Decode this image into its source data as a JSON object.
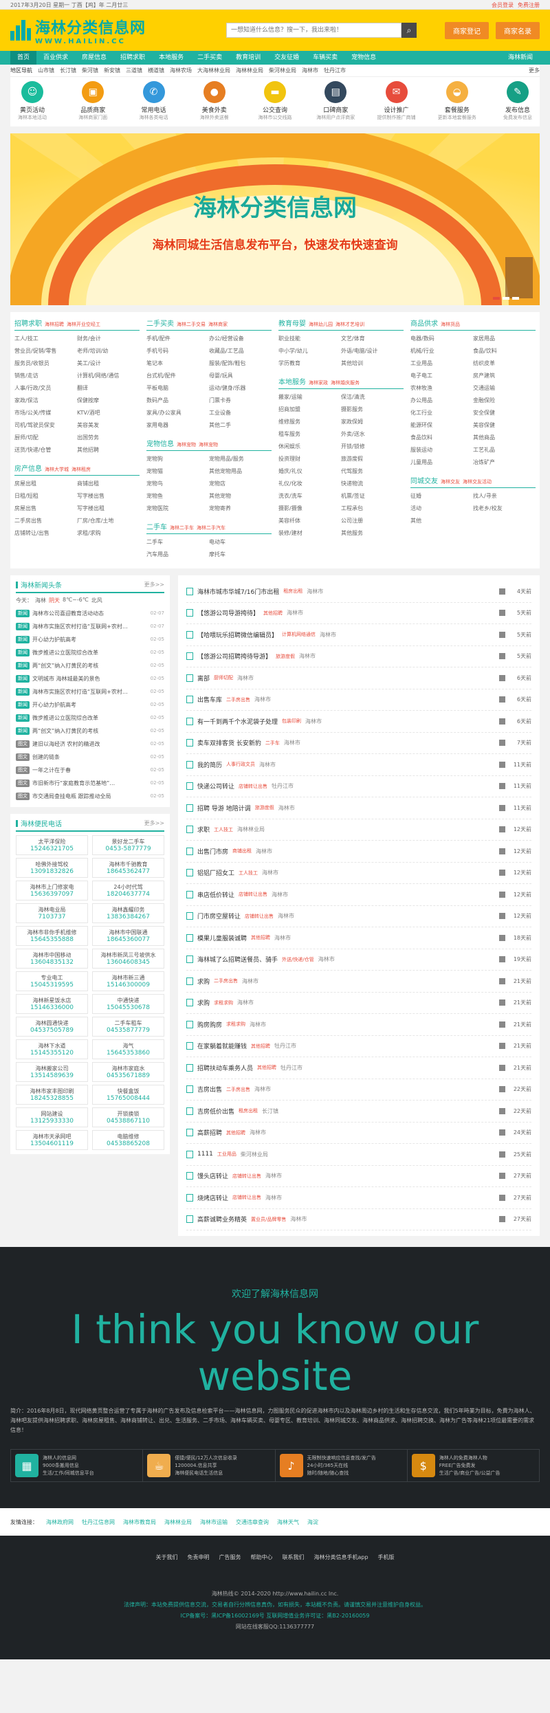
{
  "topbar": {
    "date": "2017年3月20日 星期一 丁酉【鸡】年 二月廿三",
    "login": "会员登录",
    "register": "免费注册"
  },
  "header": {
    "logo_cn": "海林分类信息网",
    "logo_en": "WWW.HAILIN.CC",
    "search_placeholder": "一想知道什么信息？搜一下，我出来啦！",
    "btn1": "商家登记",
    "btn2": "商家名录"
  },
  "nav": {
    "items": [
      "首页",
      "百业供求",
      "房屋信息",
      "招聘求职",
      "本地服务",
      "二手买卖",
      "教育培训",
      "交友征婚",
      "车辆买卖",
      "宠物信息"
    ],
    "last": "海林新闻"
  },
  "subnav": {
    "label": "地区导航",
    "areas": [
      "山市镇",
      "长汀镇",
      "柴河镇",
      "新安镇",
      "三道镇",
      "横道镇",
      "海林农场",
      "大海林林业局",
      "海林林业局",
      "柴河林业局",
      "海林市",
      "牡丹江市"
    ],
    "more": "更多"
  },
  "icons": [
    {
      "t": "黄页活动",
      "s": "海林本地活动",
      "c": "#1abc9c",
      "g": "☺"
    },
    {
      "t": "品质商家",
      "s": "海林商家门面",
      "c": "#f39c12",
      "g": "▣"
    },
    {
      "t": "常用电话",
      "s": "海林各类电话",
      "c": "#3498db",
      "g": "✆"
    },
    {
      "t": "美食外卖",
      "s": "海林外卖送餐",
      "c": "#e67e22",
      "g": "●"
    },
    {
      "t": "公交查询",
      "s": "海林市公交线路",
      "c": "#f1c40f",
      "g": "▬"
    },
    {
      "t": "口碑商家",
      "s": "海林用户点评商家",
      "c": "#34495e",
      "g": "▤"
    },
    {
      "t": "设计推广",
      "s": "提供制作推广商铺",
      "c": "#e74c3c",
      "g": "✉"
    },
    {
      "t": "套餐服务",
      "s": "更新本地套餐服务",
      "c": "#f5b041",
      "g": "◒"
    },
    {
      "t": "发布信息",
      "s": "免费发布信息",
      "c": "#16a085",
      "g": "✎"
    }
  ],
  "banner": {
    "title": "海林分类信息网",
    "sub": "海林同城生活信息发布平台，快速发布快速查询"
  },
  "cats": [
    {
      "h": "招聘求职",
      "tag": "海林招聘",
      "tag2": "海林开业空经工",
      "items": [
        "工人/技工",
        "财务/会计",
        "营业员/促销/零售",
        "老师/培训/幼",
        "服务员/收银员",
        "美工/设计",
        "销售/走访",
        "计算机/网络/通信",
        "人事/行政/文员",
        "翻译",
        "家政/保洁",
        "保健按摩",
        "市场/公关/传媒",
        "KTV/酒吧",
        "司机/驾驶员保安",
        "美容美发",
        "厨师/切配",
        "出国劳务",
        "送货/快递/仓管",
        "其他招聘"
      ]
    },
    {
      "h": "二手买卖",
      "tag": "海林二手交易",
      "tag2": "海林商家",
      "items": [
        "手机/配件",
        "办公/经营设备",
        "手机号码",
        "收藏品/工艺品",
        "笔记本",
        "服装/配饰/鞋包",
        "台式机/配件",
        "母婴/玩具",
        "平板电脑",
        "运动/健身/乐器",
        "数码产品",
        "门票卡券",
        "家具/办公家具",
        "工业设备",
        "家用电器",
        "其他二手"
      ]
    },
    {
      "h": "教育母婴",
      "tag": "海林幼儿园",
      "tag2": "海林才艺培训",
      "items": [
        "职业技能",
        "文艺/体育",
        "中小学/幼儿",
        "外语/电脑/设计",
        "学历教育",
        "其他培训"
      ]
    },
    {
      "h": "商品供求",
      "tag": "海林货品",
      "items": [
        "电器/数码",
        "家居用品",
        "机械/行业",
        "食品/饮料",
        "工业用品",
        "纺织皮革",
        "电子电工",
        "房产建筑",
        "农林牧渔",
        "交通运输",
        "办公用品",
        "金融保险",
        "化工行业",
        "安全保健",
        "能源环保",
        "美容保健",
        "食品饮料",
        "其他商品",
        "服装运动",
        "工艺礼品",
        "儿童用品",
        "冶炼矿产"
      ]
    }
  ],
  "cats2": [
    {
      "h": "本地服务",
      "tag": "海林家政",
      "tag2": "海林婚庆服务",
      "items": [
        "搬家/运输",
        "保洁/清洗",
        "招商加盟",
        "摄影服务",
        "维修服务",
        "家政保姆",
        "租车服务",
        "外卖/送水",
        "休闲娱乐",
        "开锁/锁修",
        "投资理财",
        "旅游度假",
        "婚庆/礼仪",
        "代驾服务",
        "礼仪/化妆",
        "快递物流",
        "洗衣/洗车",
        "机票/签证",
        "摄影/摄像",
        "工程承包",
        "美容纤体",
        "公司注册",
        "装修/建材",
        "其他服务"
      ]
    },
    {
      "h": "宠物信息",
      "tag": "海林宠物",
      "tag2": "海林宠物",
      "items": [
        "宠物狗",
        "宠物用品/服务",
        "宠物猫",
        "其他宠物用品",
        "宠物鸟",
        "宠物店",
        "宠物鱼",
        "其他宠物",
        "宠物医院",
        "宠物寄养"
      ]
    },
    {
      "h": "房产信息",
      "tag": "海林大学城",
      "tag2": "海林租房",
      "items": [
        "房屋出租",
        "商铺出租",
        "日租/短租",
        "写字楼出售",
        "房屋出售",
        "写字楼出租",
        "二手房出售",
        "厂房/仓库/土地",
        "店铺转让/出售",
        "求租/求购"
      ]
    },
    {
      "h": "二手车",
      "tag": "海林二手车",
      "tag2": "海林二手汽车",
      "items": [
        "二手车",
        "电动车",
        "汽车用品",
        "摩托车"
      ]
    },
    {
      "h": "同城交友",
      "tag": "海林交友",
      "tag2": "海林交友活动",
      "items": [
        "征婚",
        "找人/寻亲",
        "活动",
        "找老乡/校友",
        "其他"
      ]
    }
  ],
  "news": {
    "title": "海林新闻头条",
    "more": "更多>>",
    "weather_label": "今天：",
    "city": "海林",
    "w": "阴天",
    "temp": "8℃~-6℃",
    "wind": "北风",
    "items": [
      {
        "tag": "新闻",
        "c": "#20b2a0",
        "t": "海林市公司喜迎教育活动动态",
        "d": "02-07"
      },
      {
        "tag": "新闻",
        "c": "#20b2a0",
        "t": "海林市实施区农村打造“互联网+农村…",
        "d": "02-07"
      },
      {
        "tag": "新闻",
        "c": "#20b2a0",
        "t": "开心幼力护航高考",
        "d": "02-05"
      },
      {
        "tag": "新闻",
        "c": "#20b2a0",
        "t": "微步推进公立医院综合改革",
        "d": "02-05"
      },
      {
        "tag": "新闻",
        "c": "#20b2a0",
        "t": "两“创文”纳入打黄民的考核",
        "d": "02-05"
      },
      {
        "tag": "新闻",
        "c": "#20b2a0",
        "t": "文明城市 海林城最美的景色",
        "d": "02-05"
      },
      {
        "tag": "新闻",
        "c": "#20b2a0",
        "t": "海林市实施区农村打造“互联网+农村…",
        "d": "02-05"
      },
      {
        "tag": "新闻",
        "c": "#20b2a0",
        "t": "开心幼力护航高考",
        "d": "02-05"
      },
      {
        "tag": "新闻",
        "c": "#20b2a0",
        "t": "微步推进公立医院综合改革",
        "d": "02-05"
      },
      {
        "tag": "新闻",
        "c": "#20b2a0",
        "t": "两“创文”纳入打黄民的考核",
        "d": "02-05"
      },
      {
        "tag": "图文",
        "c": "#888",
        "t": "建旧以海经济 农村的精进改",
        "d": "02-05"
      },
      {
        "tag": "图文",
        "c": "#888",
        "t": "创建的链条",
        "d": "02-05"
      },
      {
        "tag": "图文",
        "c": "#888",
        "t": "一年之计在于春",
        "d": "02-05"
      },
      {
        "tag": "图文",
        "c": "#888",
        "t": "市旧新市行“家庭教育示范基地”…",
        "d": "02-05"
      },
      {
        "tag": "图文",
        "c": "#888",
        "t": "市交通局查挂电瓶 跟踪推动全局",
        "d": "02-05"
      }
    ]
  },
  "phones": {
    "title": "海林便民电话",
    "more": "更多>>",
    "items": [
      {
        "n": "太平洋保险",
        "p": "15246321705"
      },
      {
        "n": "景好龙二手车",
        "p": "0453-5877779"
      },
      {
        "n": "哈佛外接驾校",
        "p": "13091832826"
      },
      {
        "n": "海林市千驰教育",
        "p": "18645362477"
      },
      {
        "n": "海林市上门修家电",
        "p": "15636397097"
      },
      {
        "n": "24小时代驾",
        "p": "18204637774"
      },
      {
        "n": "海林电业局",
        "p": "7103737"
      },
      {
        "n": "海林鑫耀印务",
        "p": "13836384267"
      },
      {
        "n": "海林市非你手机维修",
        "p": "15645355888"
      },
      {
        "n": "海林市中国联通",
        "p": "18645360077"
      },
      {
        "n": "海林市中国移动",
        "p": "13604835132"
      },
      {
        "n": "海林市新凤三号坡供水",
        "p": "13604608345"
      },
      {
        "n": "专业电工",
        "p": "15045319595"
      },
      {
        "n": "海林市新三通",
        "p": "15146300009"
      },
      {
        "n": "海林新星饭水店",
        "p": "15146336000"
      },
      {
        "n": "中通快递",
        "p": "15045530678"
      },
      {
        "n": "海林圆通快递",
        "p": "04537505789"
      },
      {
        "n": "二手车租车",
        "p": "04535877779"
      },
      {
        "n": "海林下水道",
        "p": "15145355120"
      },
      {
        "n": "海气",
        "p": "15645353860"
      },
      {
        "n": "海林搬家公司",
        "p": "13514589639"
      },
      {
        "n": "海林市家庭水",
        "p": "04535671889"
      },
      {
        "n": "海林市家丰图印刷",
        "p": "18245328855"
      },
      {
        "n": "快餐盒饭",
        "p": "15765008444"
      },
      {
        "n": "网站建设",
        "p": "13125933330"
      },
      {
        "n": "开锁换锁",
        "p": "04538867110"
      },
      {
        "n": "海林市天承网吧",
        "p": "13504601119"
      },
      {
        "n": "电脑维修",
        "p": "04538865208"
      }
    ]
  },
  "listings": [
    {
      "t": "海林市城市华城7/16门市出租",
      "tg": "租房出租",
      "l": "海林市",
      "tm": "4天前"
    },
    {
      "t": "【悠游公司导游挎待】",
      "tg": "其他招聘",
      "l": "海林市",
      "tm": "5天前"
    },
    {
      "t": "【哈喂玩乐招聘微信编辑员】",
      "tg": "计算机网络通信",
      "l": "海林市",
      "tm": "5天前"
    },
    {
      "t": "【悠游公司招聘挎待导游】",
      "tg": "旅游度假",
      "l": "海林市",
      "tm": "5天前"
    },
    {
      "t": "离部",
      "tg": "厨师切配",
      "l": "海林市",
      "tm": "6天前"
    },
    {
      "t": "出售车库",
      "tg": "二手房出售",
      "l": "海林市",
      "tm": "6天前"
    },
    {
      "t": "有一千到两千个水泥袋子处理",
      "tg": "包装印刷",
      "l": "海林市",
      "tm": "6天前"
    },
    {
      "t": "卖车双排客货 长安新豹",
      "tg": "二手车",
      "l": "海林市",
      "tm": "7天前"
    },
    {
      "t": "我的简历",
      "tg": "人事行政文员",
      "l": "海林市",
      "tm": "11天前"
    },
    {
      "t": "快递公司转让",
      "tg": "店铺转让出售",
      "l": "牡丹江市",
      "tm": "11天前"
    },
    {
      "t": "招聘 导游 地陪计调",
      "tg": "旅游度假",
      "l": "海林市",
      "tm": "11天前"
    },
    {
      "t": "求职",
      "tg": "工人技工",
      "l": "海林林业局",
      "tm": "12天前"
    },
    {
      "t": "出售门市房",
      "tg": "商铺出租",
      "l": "海林市",
      "tm": "12天前"
    },
    {
      "t": "铝铝厂招女工",
      "tg": "工人技工",
      "l": "海林市",
      "tm": "12天前"
    },
    {
      "t": "串店低价转让",
      "tg": "店铺转让出售",
      "l": "海林市",
      "tm": "12天前"
    },
    {
      "t": "门市房空屋转让",
      "tg": "店铺转让出售",
      "l": "海林市",
      "tm": "12天前"
    },
    {
      "t": "模果儿童服装诚聘",
      "tg": "其他招聘",
      "l": "海林市",
      "tm": "18天前"
    },
    {
      "t": "海林城了么招聘送餐员、骑手",
      "tg": "外送/快递/仓管",
      "l": "海林市",
      "tm": "19天前"
    },
    {
      "t": "求购",
      "tg": "二手房出售",
      "l": "海林市",
      "tm": "21天前"
    },
    {
      "t": "求购",
      "tg": "求租求购",
      "l": "海林市",
      "tm": "21天前"
    },
    {
      "t": "购房购房",
      "tg": "求租求购",
      "l": "海林市",
      "tm": "21天前"
    },
    {
      "t": "在家躺着就能赚钱",
      "tg": "其他招聘",
      "l": "牡丹江市",
      "tm": "21天前"
    },
    {
      "t": "招聘扶动车乘务人员",
      "tg": "其他招聘",
      "l": "牡丹江市",
      "tm": "21天前"
    },
    {
      "t": "吉房出售",
      "tg": "二手房出售",
      "l": "海林市",
      "tm": "22天前"
    },
    {
      "t": "吉房低价出售",
      "tg": "租房出租",
      "l": "长汀镇",
      "tm": "22天前"
    },
    {
      "t": "高薪招聘",
      "tg": "其他招聘",
      "l": "海林市",
      "tm": "24天前"
    },
    {
      "t": "1111",
      "tg": "工业用品",
      "l": "柴河林业局",
      "tm": "25天前"
    },
    {
      "t": "馒头店转让",
      "tg": "店铺转让出售",
      "l": "海林市",
      "tm": "27天前"
    },
    {
      "t": "烧烤店转让",
      "tg": "店铺转让出售",
      "l": "海林市",
      "tm": "27天前"
    },
    {
      "t": "高薪诚聘业务精英",
      "tg": "置业员/品牌零售",
      "l": "海林市",
      "tm": "27天前"
    }
  ],
  "footer": {
    "hello": "欢迎了解海林信息网",
    "big": "I think you know our website",
    "intro": "简介：2016年8月8日，现代网络黄页整合运营了专属于海林的广告发布及信息检索平台——海林信息网，力图服务民众的促进海林市内以及海林周边乡村的生活和生存信息交流，我们5年時業为目标，免費为海林人、海林吧友提供海林招聘求职、海林房屋租售、海林商铺转让、出兑、生活服务、二手市场、海林车辆买卖、母婴专区、教育培训、海林同城交友、海林商品供求、海林招聘交换、海林为广告等海林21项位最需要的需求信息！",
    "features": [
      {
        "c": "#20b2a0",
        "g": "▦",
        "l1": "海林人的信息网",
        "l2": "9000条搬用信息",
        "l3": "生活/工作/同城信息平台"
      },
      {
        "c": "#f0ad4e",
        "g": "☕",
        "l1": "便捷/便民/12万人次信息收录",
        "l2": "1200004.信息共享",
        "l3": "海林便民电话生活信息"
      },
      {
        "c": "#e67e22",
        "g": "♪",
        "l1": "无限制快速响应信息查找/发广告",
        "l2": "24小时/365天在线",
        "l3": "随时/随地/随心查找"
      },
      {
        "c": "#d68910",
        "g": "$",
        "l1": "海林人的免费海林人物",
        "l2": "FREE广告免费发",
        "l3": "生活广告/商业广告/公益广告"
      }
    ]
  },
  "friendlinks": {
    "label": "友情连接：",
    "items": [
      "海林政府网",
      "牡丹江信息网",
      "海林市教育局",
      "海林林业局",
      "海林市运输",
      "交通违章查询",
      "海林天气",
      "海淀"
    ]
  },
  "bottom": {
    "menu": [
      "关于我们",
      "免责申明",
      "广告服务",
      "帮助中心",
      "联系我们",
      "海林分类信息手机app",
      "手机版"
    ],
    "copy": [
      "海林热线© 2014-2020 http://www.hailin.cc Inc.",
      "法律声明：本站免费提供信息交流，交易者自行分辨信息真伪，如有损失，本站概不负责。请谨慎交易并注意维护自身权益。",
      "ICP备案号：黑ICP备16002169号 互联网增值业务许可证：黑B2-20160059",
      "网站在线客服QQ:1136377777"
    ]
  }
}
